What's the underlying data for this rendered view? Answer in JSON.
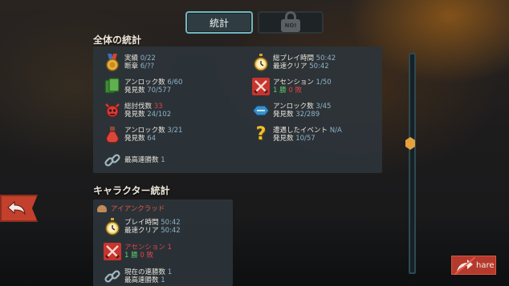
{
  "tabs": {
    "stats_label": "統計",
    "locked_badge": "NO!"
  },
  "overall": {
    "title": "全体の統計",
    "achievements": {
      "label1": "実績",
      "value1": "0/22",
      "label2": "断章",
      "value2": "6/??"
    },
    "playtime": {
      "label1": "総プレイ時間",
      "value1": "50:42",
      "label2": "最速クリア",
      "value2": "50:42"
    },
    "cards": {
      "label1": "アンロック数",
      "value1": "6/60",
      "label2": "発見数",
      "value2": "70/577"
    },
    "ascension": {
      "label1": "アセンション",
      "value1": "1/50",
      "wins": "1 勝",
      "losses": "0 敗"
    },
    "monsters": {
      "label1": "総討伐数",
      "value1": "33",
      "label2": "発見数",
      "value2": "24/102"
    },
    "relics": {
      "label1": "アンロック数",
      "value1": "3/45",
      "label2": "発見数",
      "value2": "32/289"
    },
    "potions": {
      "label1": "アンロック数",
      "value1": "3/21",
      "label2": "発見数",
      "value2": "64"
    },
    "events": {
      "label1": "遭遇したイベント",
      "value1": "N/A",
      "label2": "発見数",
      "value2": "10/57"
    },
    "streak": {
      "label1": "最高連勝数",
      "value1": "1"
    }
  },
  "character": {
    "title": "キャラクター統計",
    "name": "アイアンクラッド",
    "playtime": {
      "label1": "プレイ時間",
      "value1": "50:42",
      "label2": "最速クリア",
      "value2": "50:42"
    },
    "ascension": {
      "label1": "アセンション",
      "value1": "1",
      "wins": "1 勝",
      "losses": "0 敗"
    },
    "streak": {
      "label1": "現在の連勝数",
      "value1": "1",
      "label2": "最高連勝数",
      "value2": "1"
    }
  },
  "share": {
    "label": "hare"
  },
  "colors": {
    "accent_teal": "#6fb7c0",
    "value_blue": "#8fb3c8",
    "red": "#e0444a",
    "green": "#5fd06a",
    "thumb": "#e6a23a"
  }
}
